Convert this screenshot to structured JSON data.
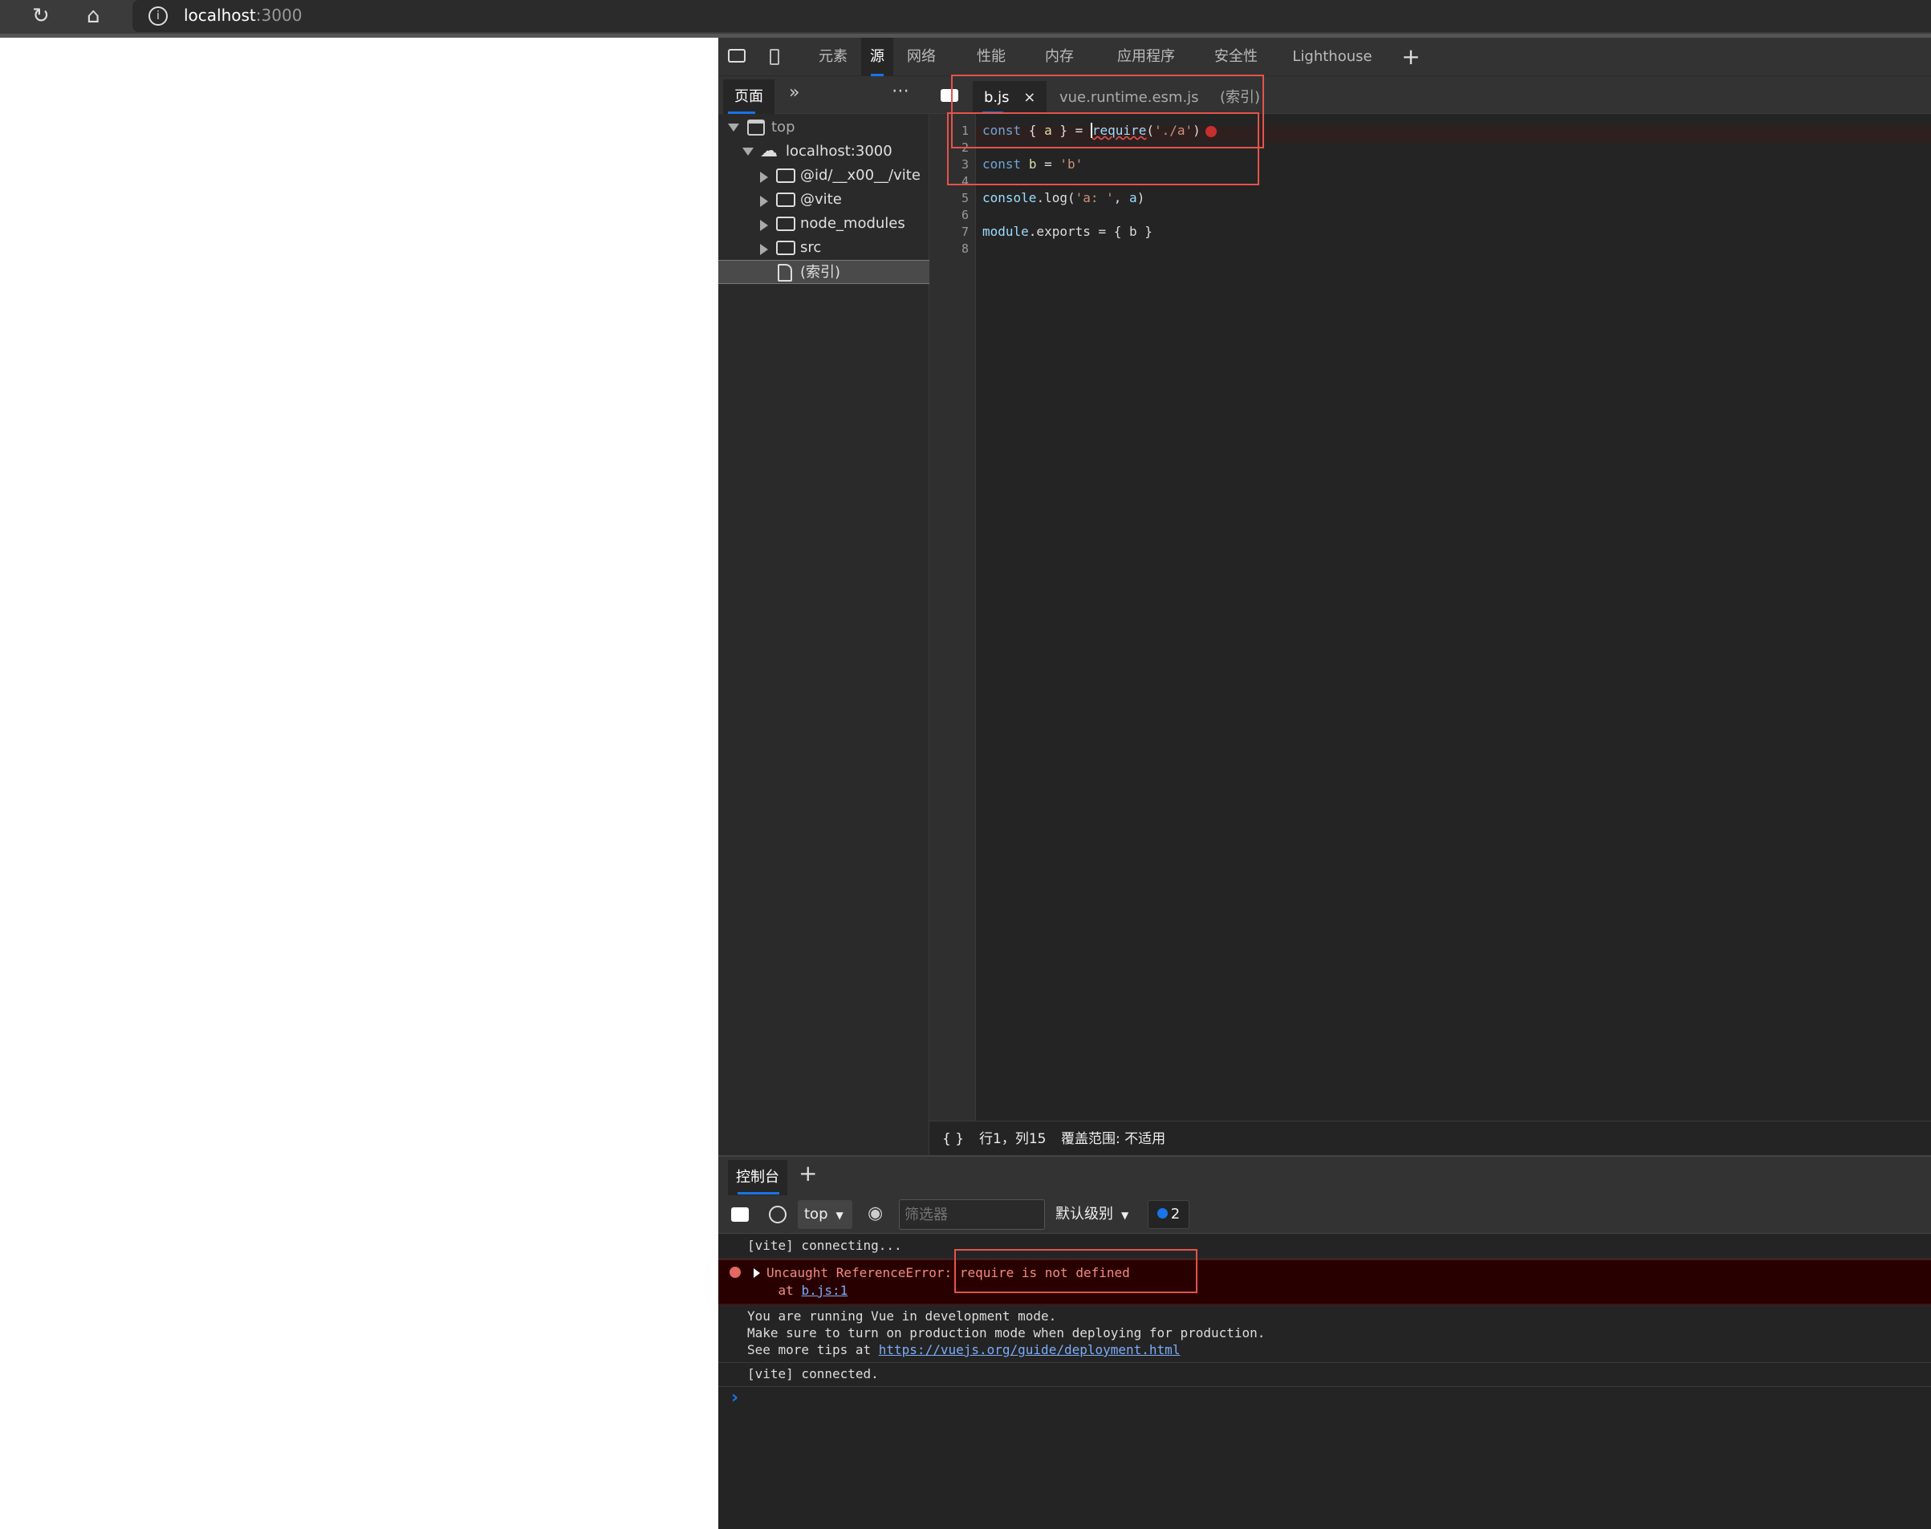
{
  "browser": {
    "url_host": "localhost",
    "url_port": ":3000",
    "icons": {
      "reload": "reload-icon",
      "home": "home-icon",
      "info": "info-icon"
    }
  },
  "devtools": {
    "main_tabs": [
      {
        "label": "元素",
        "active": false
      },
      {
        "label": "源",
        "active": true
      },
      {
        "label": "网络",
        "active": false
      },
      {
        "label": "性能",
        "active": false
      },
      {
        "label": "内存",
        "active": false
      },
      {
        "label": "应用程序",
        "active": false
      },
      {
        "label": "安全性",
        "active": false
      },
      {
        "label": "Lighthouse",
        "active": false
      }
    ],
    "add_tab": "+",
    "navigator": {
      "tab_label": "页面",
      "more_tabs": "»",
      "menu": "⋯",
      "tree": [
        {
          "label": "top",
          "level": 0,
          "type": "frame",
          "expanded": true
        },
        {
          "label": "localhost:3000",
          "level": 1,
          "type": "origin",
          "expanded": true
        },
        {
          "label": "@id/__x00__/vite",
          "level": 2,
          "type": "folder",
          "expanded": false
        },
        {
          "label": "@vite",
          "level": 2,
          "type": "folder",
          "expanded": false
        },
        {
          "label": "node_modules",
          "level": 2,
          "type": "folder",
          "expanded": false
        },
        {
          "label": "src",
          "level": 2,
          "type": "folder",
          "expanded": false
        },
        {
          "label": "(索引)",
          "level": 2,
          "type": "file",
          "selected": true
        }
      ]
    },
    "editor": {
      "tabs": [
        {
          "label": "b.js",
          "active": true,
          "closable": true
        },
        {
          "label": "vue.runtime.esm.js",
          "active": false
        },
        {
          "label": "(索引)",
          "active": false
        }
      ],
      "close_glyph": "×",
      "lines": [
        "1",
        "2",
        "3",
        "4",
        "5",
        "6",
        "7",
        "8"
      ],
      "code": {
        "l1": {
          "kw": "const",
          "p1": " { ",
          "v": "a",
          "p2": " } = ",
          "fn": "require",
          "p3": "(",
          "s": "'./a'",
          "p4": ")"
        },
        "l3": {
          "kw": "const",
          "p1": " ",
          "v": "b",
          "p2": " = ",
          "s": "'b'"
        },
        "l5": {
          "obj": "console",
          "p1": ".log(",
          "s": "'a: '",
          "p2": ", ",
          "v": "a",
          "p3": ")"
        },
        "l7": {
          "obj": "module",
          "p1": ".exports = { b }"
        }
      },
      "status": {
        "pretty_print": "{ }",
        "position": "行1，列15",
        "coverage": "覆盖范围: 不适用"
      }
    },
    "drawer": {
      "tab_label": "控制台",
      "add_tab": "+",
      "toolbar": {
        "context": "top",
        "filter_placeholder": "筛选器",
        "level": "默认级别",
        "issues_count": "2"
      },
      "messages": [
        {
          "type": "log",
          "text": "[vite] connecting..."
        },
        {
          "type": "error",
          "prefix": "Uncaught ReferenceError: ",
          "message": "require is not defined",
          "at": "    at ",
          "link": "b.js:1"
        },
        {
          "type": "log",
          "lines": [
            "You are running Vue in development mode.",
            "Make sure to turn on production mode when deploying for production.",
            "See more tips at "
          ],
          "link": "https://vuejs.org/guide/deployment.html"
        },
        {
          "type": "log",
          "text": "[vite] connected."
        }
      ],
      "prompt": "›"
    }
  },
  "colors": {
    "accent": "#1a73e8",
    "error_bg": "#290000",
    "error_text": "#f28b82",
    "highlight_box": "#e5534b"
  }
}
